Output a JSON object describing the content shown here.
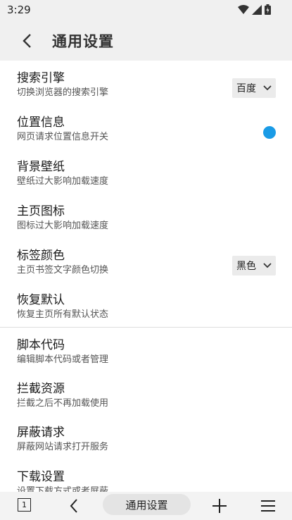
{
  "status_bar": {
    "time": "3:29"
  },
  "header": {
    "title": "通用设置"
  },
  "settings": {
    "items": [
      {
        "title": "搜索引擎",
        "subtitle": "切换浏览器的搜索引擎",
        "control": "select",
        "value": "百度"
      },
      {
        "title": "位置信息",
        "subtitle": "网页请求位置信息开关",
        "control": "toggle",
        "value": "on"
      },
      {
        "title": "背景壁纸",
        "subtitle": "壁纸过大影响加载速度"
      },
      {
        "title": "主页图标",
        "subtitle": "图标过大影响加载速度"
      },
      {
        "title": "标签颜色",
        "subtitle": "主页书签文字颜色切换",
        "control": "select",
        "value": "黑色"
      },
      {
        "title": "恢复默认",
        "subtitle": "恢复主页所有默认状态"
      },
      {
        "title": "脚本代码",
        "subtitle": "编辑脚本代码或者管理"
      },
      {
        "title": "拦截资源",
        "subtitle": "拦截之后不再加载使用"
      },
      {
        "title": "屏蔽请求",
        "subtitle": "屏蔽网站请求打开服务"
      },
      {
        "title": "下载设置",
        "subtitle": "设置下载方式或者屏蔽"
      }
    ]
  },
  "bottom_bar": {
    "tab_count": "1",
    "current_label": "通用设置"
  },
  "colors": {
    "toggle_on": "#1a9be6",
    "header_bg": "#f0f0f0"
  }
}
